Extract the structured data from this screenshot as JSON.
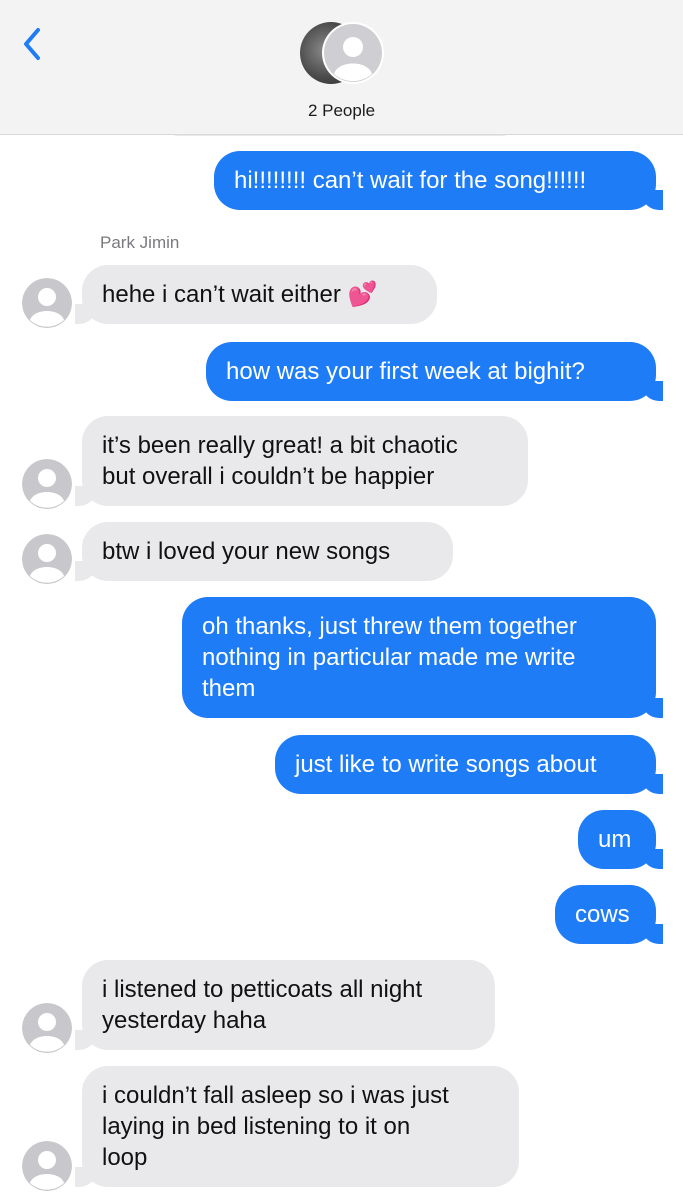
{
  "header": {
    "title": "2 People"
  },
  "thread": {
    "sender_name": "Park Jimin",
    "messages": [
      {
        "dir": "out",
        "text": "hi!!!!!!!! can’t wait for the song!!!!!!"
      },
      {
        "dir": "in",
        "text": "hehe i can’t wait either 💕"
      },
      {
        "dir": "out",
        "text": "how was your first week at bighit?"
      },
      {
        "dir": "in",
        "lines": [
          "it’s been really great! a bit chaotic",
          "but overall i couldn’t be happier"
        ]
      },
      {
        "dir": "in",
        "text": "btw i loved your new songs"
      },
      {
        "dir": "out",
        "lines": [
          "oh thanks, just threw them together",
          "nothing in particular made me write",
          "them"
        ]
      },
      {
        "dir": "out",
        "text": "just like to write songs about"
      },
      {
        "dir": "out",
        "text": "um"
      },
      {
        "dir": "out",
        "text": "cows"
      },
      {
        "dir": "in",
        "lines": [
          "i listened to petticoats all night",
          "yesterday haha"
        ]
      },
      {
        "dir": "in",
        "lines": [
          "i couldn’t fall asleep so i was just",
          "laying in bed listening to it on",
          "loop"
        ]
      }
    ]
  },
  "colors": {
    "outgoing_bubble": "#1e7cf6",
    "incoming_bubble": "#e9e9ec",
    "accent": "#1e7cf6"
  },
  "icons": {
    "back": "chevron-left-icon",
    "avatar": "person-silhouette-icon"
  }
}
